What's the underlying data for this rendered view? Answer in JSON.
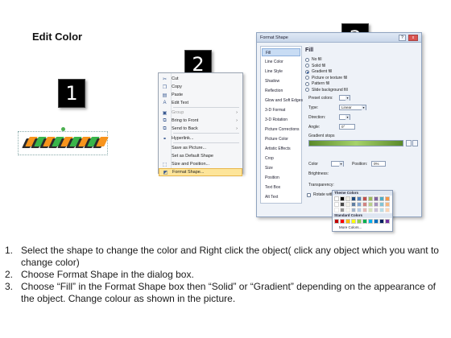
{
  "title": "Edit Color",
  "badges": [
    "1",
    "2",
    "3"
  ],
  "shape_colors": [
    "#f7941d",
    "#39b54a",
    "#a6a6a6",
    "#2b2b2b"
  ],
  "context_menu": {
    "items": [
      {
        "label": "Cut",
        "icon": "scissors-icon",
        "underline": "t"
      },
      {
        "label": "Copy",
        "icon": "copy-icon"
      },
      {
        "label": "Paste",
        "icon": "paste-icon"
      },
      {
        "label": "Edit Text",
        "icon": "edit-text-icon"
      },
      {
        "label": "Group",
        "icon": "group-icon",
        "disabled": true,
        "submenu": true
      },
      {
        "label": "Bring to Front",
        "icon": "bring-front-icon",
        "submenu": true
      },
      {
        "label": "Send to Back",
        "icon": "send-back-icon",
        "submenu": true
      },
      {
        "label": "Hyperlink...",
        "icon": "hyperlink-icon"
      },
      {
        "label": "Save as Picture...",
        "icon": ""
      },
      {
        "label": "Set as Default Shape",
        "icon": ""
      },
      {
        "label": "Size and Position...",
        "icon": "size-icon"
      },
      {
        "label": "Format Shape...",
        "icon": "format-shape-icon",
        "active": true
      }
    ]
  },
  "format_dialog": {
    "title": "Format Shape",
    "help_label": "?",
    "close_label": "x",
    "nav": [
      "Fill",
      "Line Color",
      "Line Style",
      "Shadow",
      "Reflection",
      "Glow and Soft Edges",
      "3-D Format",
      "3-D Rotation",
      "Picture Corrections",
      "Picture Color",
      "Artistic Effects",
      "Crop",
      "Size",
      "Position",
      "Text Box",
      "Alt Text"
    ],
    "nav_active": 0,
    "heading": "Fill",
    "fill_options": [
      "No fill",
      "Solid fill",
      "Gradient fill",
      "Picture or texture fill",
      "Pattern fill",
      "Slide background fill"
    ],
    "fill_selected": 2,
    "preset_label": "Preset colors:",
    "type_label": "Type:",
    "type_value": "Linear",
    "direction_label": "Direction:",
    "angle_label": "Angle:",
    "angle_value": "0°",
    "gradient_stops_label": "Gradient stops",
    "color_label": "Color",
    "position_label": "Position:",
    "position_value": "0%",
    "brightness_label": "Brightness:",
    "transparency_label": "Transparency:",
    "rotate_label": "Rotate with shape"
  },
  "palette": {
    "theme_label": "Theme Colors",
    "standard_label": "Standard Colors",
    "more_label": "More Colors...",
    "theme_top": [
      "#ffffff",
      "#000000",
      "#eeece1",
      "#1f497d",
      "#4f81bd",
      "#c0504d",
      "#9bbb59",
      "#8064a2",
      "#4bacc6",
      "#f79646"
    ],
    "standard": [
      "#c00000",
      "#ff0000",
      "#ffc000",
      "#ffff00",
      "#92d050",
      "#00b050",
      "#00b0f0",
      "#0070c0",
      "#002060",
      "#7030a0"
    ]
  },
  "steps": [
    {
      "num": "1.",
      "text": "Select the shape to change the color and Right click the object( click any object which you want to change color)"
    },
    {
      "num": "2.",
      "text": "Choose Format Shape in the dialog box."
    },
    {
      "num": "3.",
      "text": "Choose “Fill” in the Format Shape box then “Solid” or “Gradient” depending on the appearance of the object. Change colour as shown in the picture."
    }
  ]
}
